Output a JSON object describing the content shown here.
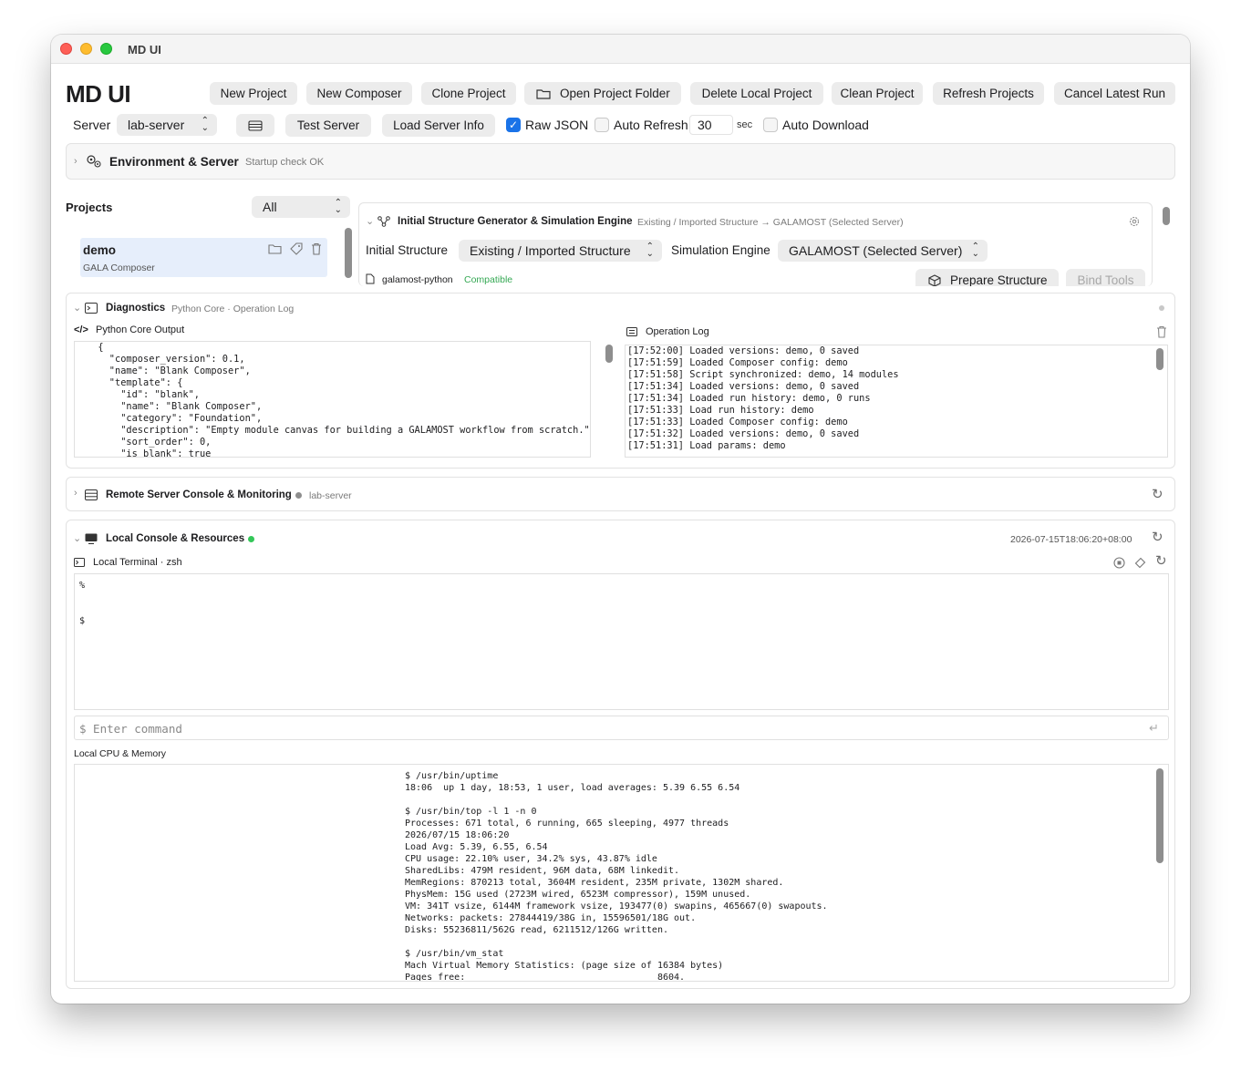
{
  "window": {
    "title": "MD UI"
  },
  "app": {
    "title": "MD UI"
  },
  "toolbar": {
    "new_project": "New Project",
    "new_composer": "New Composer",
    "clone_project": "Clone Project",
    "open_project_folder": "Open Project Folder",
    "delete_local_project": "Delete Local Project",
    "clean_project": "Clean Project",
    "refresh_projects": "Refresh Projects",
    "cancel_latest_run": "Cancel Latest Run"
  },
  "server_bar": {
    "server_label": "Server",
    "server_value": "lab-server",
    "test_server": "Test Server",
    "load_server_info": "Load Server Info",
    "raw_json_label": "Raw JSON",
    "raw_json_checked": true,
    "auto_refresh_label": "Auto Refresh",
    "auto_refresh_checked": false,
    "refresh_interval": "30",
    "refresh_unit": "sec",
    "auto_download_label": "Auto Download",
    "auto_download_checked": false
  },
  "environment": {
    "title": "Environment & Server",
    "status": "Startup check OK"
  },
  "projects": {
    "title": "Projects",
    "filter_value": "All",
    "items": [
      {
        "name": "demo",
        "subtitle": "GALA Composer"
      }
    ]
  },
  "generator": {
    "title": "Initial Structure Generator & Simulation Engine",
    "summary": "Existing / Imported Structure → GALAMOST (Selected Server)",
    "initial_structure_label": "Initial Structure",
    "initial_structure_value": "Existing / Imported Structure",
    "simulation_engine_label": "Simulation Engine",
    "simulation_engine_value": "GALAMOST (Selected Server)",
    "package": "galamost-python",
    "compat": "Compatible",
    "prepare_structure": "Prepare Structure",
    "bind_tools": "Bind Tools"
  },
  "diagnostics": {
    "title": "Diagnostics",
    "subtitle": "Python Core · Operation Log",
    "python_output_label": "Python Core Output",
    "python_output": "  {\n    \"composer_version\": 0.1,\n    \"name\": \"Blank Composer\",\n    \"template\": {\n      \"id\": \"blank\",\n      \"name\": \"Blank Composer\",\n      \"category\": \"Foundation\",\n      \"description\": \"Empty module canvas for building a GALAMOST workflow from scratch.\",\n      \"sort_order\": 0,\n      \"is_blank\": true",
    "operation_log_label": "Operation Log",
    "operation_log": "[17:52:00] Loaded versions: demo, 0 saved\n[17:51:59] Loaded Composer config: demo\n[17:51:58] Script synchronized: demo, 14 modules\n[17:51:34] Loaded versions: demo, 0 saved\n[17:51:34] Loaded run history: demo, 0 runs\n[17:51:33] Load run history: demo\n[17:51:33] Loaded Composer config: demo\n[17:51:32] Loaded versions: demo, 0 saved\n[17:51:31] Load params: demo"
  },
  "remote_console": {
    "title": "Remote Server Console & Monitoring",
    "server": "lab-server"
  },
  "local_console": {
    "title": "Local Console & Resources",
    "timestamp": "2026-07-15T18:06:20+08:00",
    "terminal_label": "Local Terminal · zsh",
    "terminal_output": "%\n\n\n$",
    "command_placeholder": "$ Enter command",
    "cpu_label": "Local CPU & Memory",
    "cpu_output": "$ /usr/bin/uptime\n18:06  up 1 day, 18:53, 1 user, load averages: 5.39 6.55 6.54\n\n$ /usr/bin/top -l 1 -n 0\nProcesses: 671 total, 6 running, 665 sleeping, 4977 threads\n2026/07/15 18:06:20\nLoad Avg: 5.39, 6.55, 6.54\nCPU usage: 22.10% user, 34.2% sys, 43.87% idle\nSharedLibs: 479M resident, 96M data, 68M linkedit.\nMemRegions: 870213 total, 3604M resident, 235M private, 1302M shared.\nPhysMem: 15G used (2723M wired, 6523M compressor), 159M unused.\nVM: 341T vsize, 6144M framework vsize, 193477(0) swapins, 465667(0) swapouts.\nNetworks: packets: 27844419/38G in, 15596501/18G out.\nDisks: 55236811/562G read, 6211512/126G written.\n\n$ /usr/bin/vm_stat\nMach Virtual Memory Statistics: (page size of 16384 bytes)\nPages free:                                   8604."
  },
  "colors": {
    "accent": "#1a73e8",
    "ok_green": "#34c759",
    "muted_grey": "#8e8e8e"
  }
}
